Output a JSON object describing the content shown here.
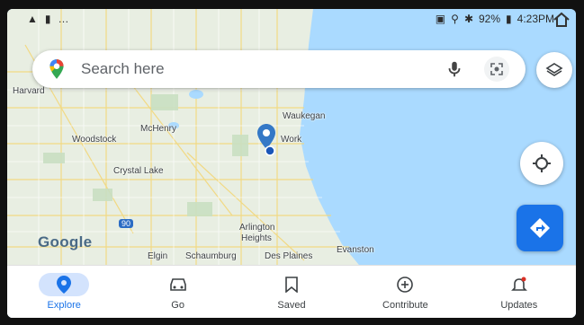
{
  "status": {
    "left_icons": [
      "signal-icon",
      "bar-icon",
      "dots-icon"
    ],
    "battery": "92%",
    "time": "4:23PM"
  },
  "search": {
    "placeholder": "Search here"
  },
  "map": {
    "labels": [
      "Harvard",
      "Woodstock",
      "McHenry",
      "Crystal Lake",
      "Waukegan",
      "Work",
      "Arlington",
      "Heights",
      "Elgin",
      "Schaumburg",
      "Des Plaines",
      "Evanston"
    ],
    "logo": "Google",
    "route_shield": "90",
    "colors": {
      "water": "#aadaff",
      "land": "#e8eee2",
      "accent": "#1a73e8"
    }
  },
  "nav": {
    "items": [
      {
        "label": "Explore",
        "icon": "explore-pin-icon",
        "active": true
      },
      {
        "label": "Go",
        "icon": "car-icon"
      },
      {
        "label": "Saved",
        "icon": "bookmark-icon"
      },
      {
        "label": "Contribute",
        "icon": "plus-circle-icon"
      },
      {
        "label": "Updates",
        "icon": "bell-icon"
      }
    ]
  }
}
